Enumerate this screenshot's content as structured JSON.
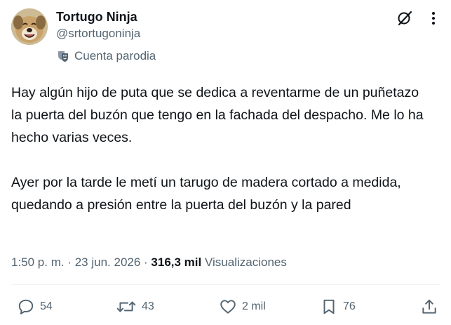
{
  "author": {
    "display_name": "Tortugo Ninja",
    "handle": "@srtortugoninja",
    "label": "Cuenta parodia",
    "label_icon": "parody-mask-icon"
  },
  "header_icons": [
    "grok-icon",
    "more-icon"
  ],
  "tweet": {
    "text": "Hay algún hijo de puta que se dedica a reventarme de un puñetazo la puerta del buzón que tengo en la fachada del despacho. Me lo ha hecho varias veces.\n\nAyer por la tarde le metí un tarugo de madera cortado a medida, quedando a presión entre la puerta del buzón y la pared"
  },
  "meta": {
    "time": "1:50 p. m.",
    "separator": " · ",
    "date": "23 jun. 2026",
    "views_count": "316,3 mil",
    "views_label": "Visualizaciones"
  },
  "actions": {
    "replies": "54",
    "retweets": "43",
    "likes": "2 mil",
    "bookmarks": "76"
  },
  "colors": {
    "text": "#0f1419",
    "secondary": "#536471",
    "divider": "#eff3f4"
  }
}
